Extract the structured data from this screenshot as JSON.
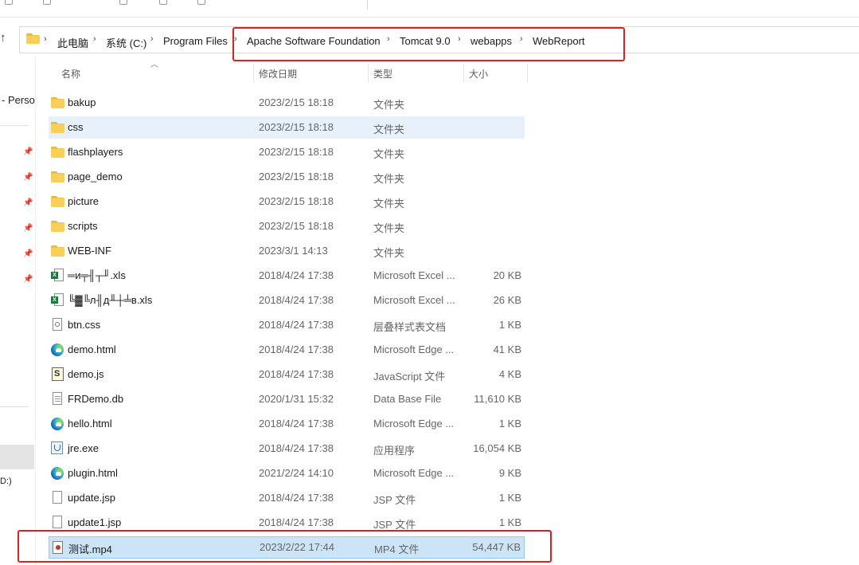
{
  "nav_up_label": "↑",
  "breadcrumb": [
    "此电脑",
    "系统 (C:)",
    "Program Files",
    "Apache Software Foundation",
    "Tomcat 9.0",
    "webapps",
    "WebReport"
  ],
  "columns": {
    "name": "名称",
    "date": "修改日期",
    "type": "类型",
    "size": "大小"
  },
  "nav_pane": {
    "truncated_item": "- Perso",
    "drive_fragment": "D:)"
  },
  "files": [
    {
      "name": "bakup",
      "date": "2023/2/15 18:18",
      "type": "文件夹",
      "size": "",
      "icon": "folder-icon"
    },
    {
      "name": "css",
      "date": "2023/2/15 18:18",
      "type": "文件夹",
      "size": "",
      "icon": "folder-icon"
    },
    {
      "name": "flashplayers",
      "date": "2023/2/15 18:18",
      "type": "文件夹",
      "size": "",
      "icon": "folder-icon"
    },
    {
      "name": "page_demo",
      "date": "2023/2/15 18:18",
      "type": "文件夹",
      "size": "",
      "icon": "folder-icon"
    },
    {
      "name": "picture",
      "date": "2023/2/15 18:18",
      "type": "文件夹",
      "size": "",
      "icon": "folder-icon"
    },
    {
      "name": "scripts",
      "date": "2023/2/15 18:18",
      "type": "文件夹",
      "size": "",
      "icon": "folder-icon"
    },
    {
      "name": "WEB-INF",
      "date": "2023/3/1 14:13",
      "type": "文件夹",
      "size": "",
      "icon": "folder-icon"
    },
    {
      "name": "═и╤╢┬╜.xls",
      "date": "2018/4/24 17:38",
      "type": "Microsoft Excel ...",
      "size": "20 KB",
      "icon": "excel-icon"
    },
    {
      "name": "╚▓╚л╢д╨┼╧в.xls",
      "date": "2018/4/24 17:38",
      "type": "Microsoft Excel ...",
      "size": "26 KB",
      "icon": "excel-icon"
    },
    {
      "name": "btn.css",
      "date": "2018/4/24 17:38",
      "type": "层叠样式表文档",
      "size": "1 KB",
      "icon": "css-file-icon"
    },
    {
      "name": "demo.html",
      "date": "2018/4/24 17:38",
      "type": "Microsoft Edge ...",
      "size": "41 KB",
      "icon": "edge-icon"
    },
    {
      "name": "demo.js",
      "date": "2018/4/24 17:38",
      "type": "JavaScript 文件",
      "size": "4 KB",
      "icon": "javascript-file-icon"
    },
    {
      "name": "FRDemo.db",
      "date": "2020/1/31 15:32",
      "type": "Data Base File",
      "size": "11,610 KB",
      "icon": "database-file-icon"
    },
    {
      "name": "hello.html",
      "date": "2018/4/24 17:38",
      "type": "Microsoft Edge ...",
      "size": "1 KB",
      "icon": "edge-icon"
    },
    {
      "name": "jre.exe",
      "date": "2018/4/24 17:38",
      "type": "应用程序",
      "size": "16,054 KB",
      "icon": "executable-icon"
    },
    {
      "name": "plugin.html",
      "date": "2021/2/24 14:10",
      "type": "Microsoft Edge ...",
      "size": "9 KB",
      "icon": "edge-icon"
    },
    {
      "name": "update.jsp",
      "date": "2018/4/24 17:38",
      "type": "JSP 文件",
      "size": "1 KB",
      "icon": "blank-file-icon"
    },
    {
      "name": "update1.jsp",
      "date": "2018/4/24 17:38",
      "type": "JSP 文件",
      "size": "1 KB",
      "icon": "blank-file-icon"
    },
    {
      "name": "测试.mp4",
      "date": "2023/2/22 17:44",
      "type": "MP4 文件",
      "size": "54,447 KB",
      "icon": "video-file-icon"
    }
  ],
  "colors": {
    "highlight_box": "#e02020",
    "hover_row": "#e6f1fb",
    "selected_row": "#cce4f7"
  }
}
